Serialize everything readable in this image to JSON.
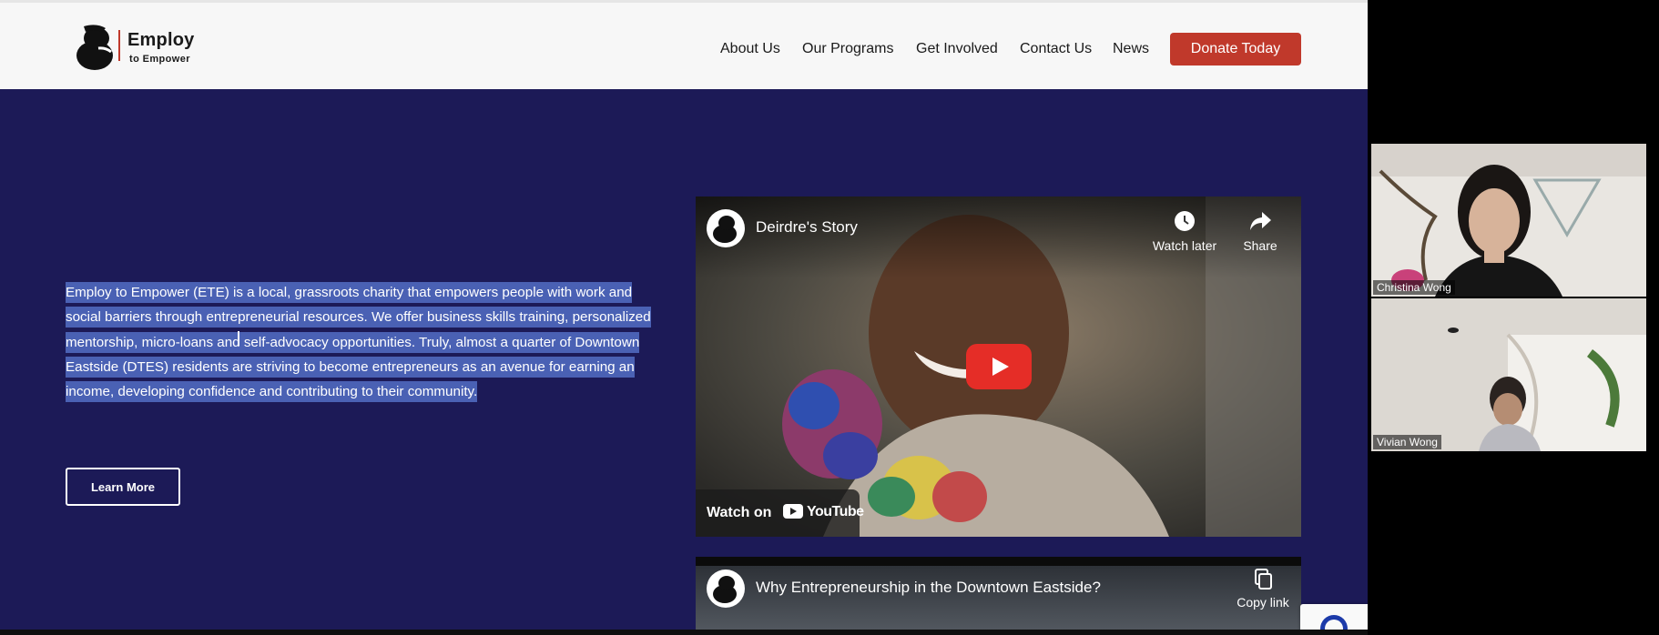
{
  "site": {
    "logo": {
      "line1": "Employ",
      "line2": "to  Empower"
    },
    "nav": [
      {
        "label": "About Us"
      },
      {
        "label": "Our Programs"
      },
      {
        "label": "Get Involved"
      },
      {
        "label": "Contact Us"
      },
      {
        "label": "News"
      }
    ],
    "donate_label": "Donate Today"
  },
  "main": {
    "paragraph": "Employ to Empower (ETE) is a local, grassroots charity that empowers people with work and social barriers through entrepreneurial resources. We offer business skills training, personalized mentorship, micro-loans and self-advocacy opportunities. Truly, almost a quarter of Downtown Eastside (DTES) residents are striving to become entrepreneurs as an avenue for earning an income, developing confidence and contributing to their community.",
    "learn_more_label": "Learn More"
  },
  "videos": [
    {
      "title": "Deirdre's Story",
      "watch_later_label": "Watch later",
      "share_label": "Share",
      "watch_on_label": "Watch on",
      "platform_label": "YouTube"
    },
    {
      "title": "Why Entrepreneurship in the Downtown Eastside?",
      "copy_link_label": "Copy link"
    }
  ],
  "participants": [
    {
      "name": "Christina Wong"
    },
    {
      "name": "Vivian Wong"
    }
  ],
  "colors": {
    "page_background": "#1c1a57",
    "accent": "#c0392b",
    "selection": "#4a61b4"
  }
}
